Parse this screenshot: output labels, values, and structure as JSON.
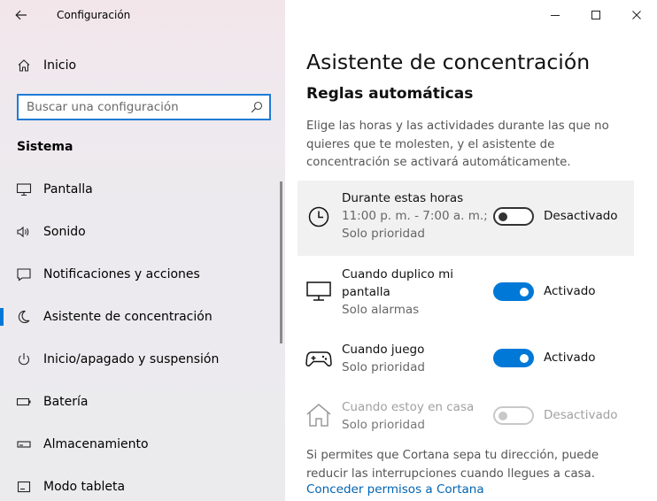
{
  "window": {
    "app_title": "Configuración"
  },
  "sidebar": {
    "home_label": "Inicio",
    "search_placeholder": "Buscar una configuración",
    "section_title": "Sistema",
    "items": [
      {
        "label": "Pantalla",
        "icon": "monitor-icon"
      },
      {
        "label": "Sonido",
        "icon": "speaker-icon"
      },
      {
        "label": "Notificaciones y acciones",
        "icon": "notification-icon"
      },
      {
        "label": "Asistente de concentración",
        "icon": "moon-icon",
        "active": true
      },
      {
        "label": "Inicio/apagado y suspensión",
        "icon": "power-icon"
      },
      {
        "label": "Batería",
        "icon": "battery-icon"
      },
      {
        "label": "Almacenamiento",
        "icon": "storage-icon"
      },
      {
        "label": "Modo tableta",
        "icon": "tablet-icon"
      }
    ]
  },
  "main": {
    "title": "Asistente de concentración",
    "subtitle": "Reglas automáticas",
    "description": "Elige las horas y las actividades durante las que no quieres que te molesten, y el asistente de concentración se activará automáticamente.",
    "rules": [
      {
        "name": "Durante estas horas",
        "detail1": "11:00 p. m. - 7:00 a. m.;",
        "detail2": "Solo prioridad",
        "state": "Desactivado",
        "on": false,
        "icon": "clock-icon"
      },
      {
        "name": "Cuando duplico mi pantalla",
        "detail1": "Solo alarmas",
        "state": "Activado",
        "on": true,
        "icon": "monitor-icon"
      },
      {
        "name": "Cuando juego",
        "detail1": "Solo prioridad",
        "state": "Activado",
        "on": true,
        "icon": "gamepad-icon"
      },
      {
        "name": "Cuando estoy en casa",
        "detail1": "Solo prioridad",
        "state": "Desactivado",
        "on": false,
        "disabled": true,
        "icon": "home-icon"
      }
    ],
    "footer_text": "Si permites que Cortana sepa tu dirección, puede reducir las interrupciones cuando llegues a casa.",
    "cortana_link": "Conceder permisos a Cortana"
  },
  "colors": {
    "accent": "#0078d7",
    "link": "#0063b1"
  }
}
